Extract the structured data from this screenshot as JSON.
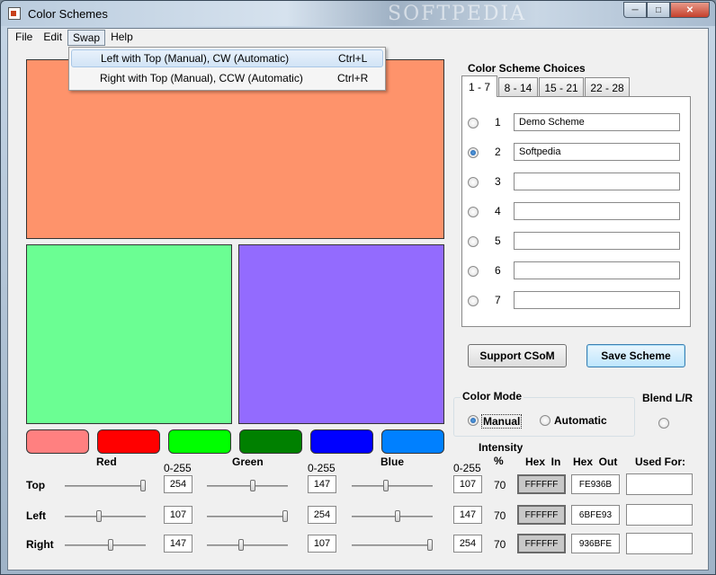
{
  "window": {
    "title": "Color Schemes",
    "watermark": "SOFTPEDIA",
    "min_icon": "minimize-icon",
    "max_icon": "maximize-icon",
    "close_icon": "close-icon"
  },
  "menu": {
    "items": [
      "File",
      "Edit",
      "Swap",
      "Help"
    ],
    "open_menu": "Swap",
    "dropdown": [
      {
        "label": "Left with Top (Manual), CW (Automatic)",
        "shortcut": "Ctrl+L",
        "highlighted": true
      },
      {
        "label": "Right with Top (Manual), CCW (Automatic)",
        "shortcut": "Ctrl+R",
        "highlighted": false
      }
    ]
  },
  "colors": {
    "top": "#FE936B",
    "left": "#6BFE93",
    "right": "#936BFE",
    "buttons": [
      "#FF8080",
      "#FF0000",
      "#00FF00",
      "#008000",
      "#0000FF",
      "#0080FF"
    ]
  },
  "channels": {
    "red_label": "Red",
    "green_label": "Green",
    "blue_label": "Blue",
    "range_label": "0-255"
  },
  "rows": [
    {
      "name": "Top",
      "red": "254",
      "green": "147",
      "blue": "107",
      "intensity": "70",
      "hex_in": "FFFFFF",
      "hex_out": "FE936B",
      "red_level": 0.996,
      "green_level": 0.576,
      "blue_level": 0.42
    },
    {
      "name": "Left",
      "red": "107",
      "green": "254",
      "blue": "147",
      "intensity": "70",
      "hex_in": "FFFFFF",
      "hex_out": "6BFE93",
      "red_level": 0.42,
      "green_level": 0.996,
      "blue_level": 0.576
    },
    {
      "name": "Right",
      "red": "147",
      "green": "107",
      "blue": "254",
      "intensity": "70",
      "hex_in": "FFFFFF",
      "hex_out": "936BFE",
      "red_level": 0.576,
      "green_level": 0.42,
      "blue_level": 0.996
    }
  ],
  "columns": {
    "intensity": "Intensity",
    "intensity_unit": "%",
    "hex_in": "Hex  In",
    "hex_out": "Hex  Out",
    "used_for": "Used For:"
  },
  "schemes": {
    "heading": "Color Scheme Choices",
    "tabs": [
      "1 - 7",
      "8 - 14",
      "15 - 21",
      "22 - 28"
    ],
    "active_tab": "1 - 7",
    "selected": "2",
    "rows": [
      {
        "num": "1",
        "name": "Demo Scheme"
      },
      {
        "num": "2",
        "name": "Softpedia"
      },
      {
        "num": "3",
        "name": ""
      },
      {
        "num": "4",
        "name": ""
      },
      {
        "num": "5",
        "name": ""
      },
      {
        "num": "6",
        "name": ""
      },
      {
        "num": "7",
        "name": ""
      }
    ]
  },
  "buttons": {
    "support": "Support CSoM",
    "save": "Save Scheme"
  },
  "color_mode": {
    "title": "Color Mode",
    "manual": "Manual",
    "automatic": "Automatic",
    "selected": "Manual"
  },
  "blend": {
    "label": "Blend L/R"
  }
}
